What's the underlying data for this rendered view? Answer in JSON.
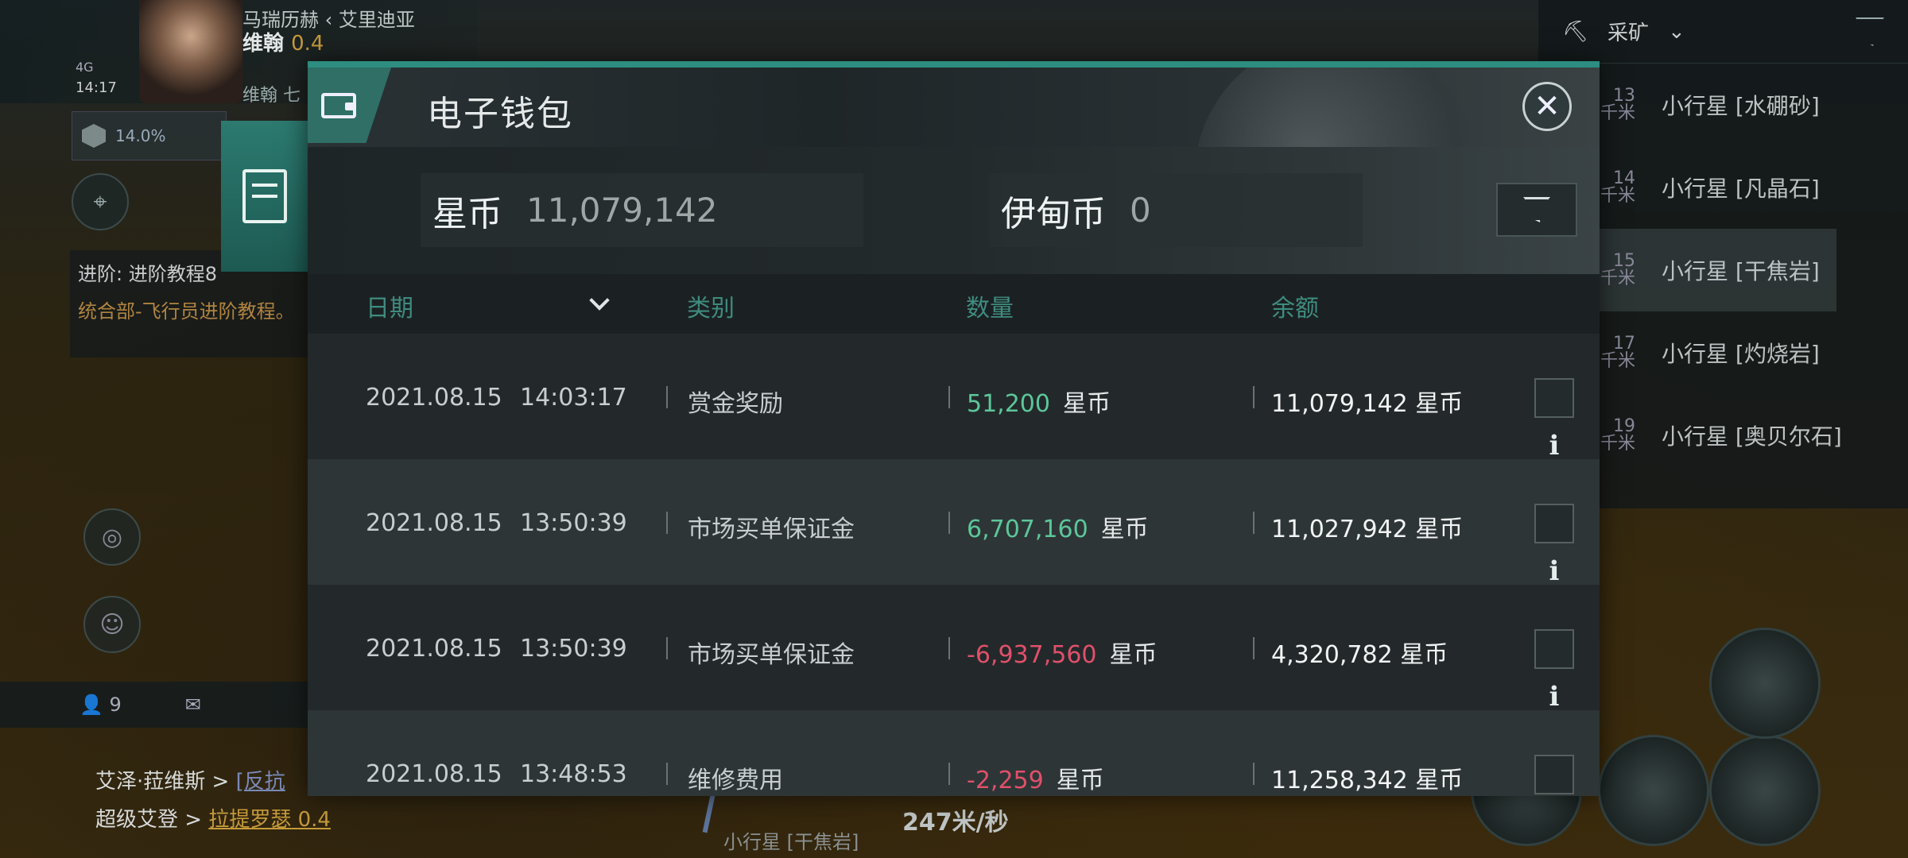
{
  "hud": {
    "pilot_route": "马瑞历赫 ‹ 艾里迪亚",
    "pilot_name": "维翰",
    "security": "0.4",
    "sub_name": "维翰 七",
    "signal": "4G",
    "time": "14:17",
    "cargo_percent": "14.0%",
    "quest_title": "进阶: 进阶教程8",
    "quest_desc": "统合部-飞行员进阶教程。",
    "chat_count": "9",
    "chat_lines": [
      {
        "name": "艾泽·菈维斯 >",
        "target": "[反抗",
        "gold": ""
      },
      {
        "name": "超级艾登 >",
        "target": "拉提罗瑟",
        "gold": "0.4"
      }
    ],
    "speed": "247米/秒",
    "target_label": "小行星 [干焦岩]"
  },
  "overview": {
    "filter_label": "采矿",
    "items": [
      {
        "dist": "13",
        "unit": "千米",
        "name": "小行星 [水硼砂]",
        "active": false
      },
      {
        "dist": "14",
        "unit": "千米",
        "name": "小行星 [凡晶石]",
        "active": false
      },
      {
        "dist": "15",
        "unit": "千米",
        "name": "小行星 [干焦岩]",
        "active": true
      },
      {
        "dist": "17",
        "unit": "千米",
        "name": "小行星 [灼烧岩]",
        "active": false
      },
      {
        "dist": "19",
        "unit": "千米",
        "name": "小行星 [奥贝尔石]",
        "active": false
      }
    ]
  },
  "wallet": {
    "title": "电子钱包",
    "star_label": "星币",
    "star_value": "11,079,142",
    "isk_label": "伊甸币",
    "isk_value": "0",
    "columns": {
      "date": "日期",
      "category": "类别",
      "amount": "数量",
      "balance": "余额"
    },
    "rows": [
      {
        "date": "2021.08.15",
        "time": "14:03:17",
        "category": "赏金奖励",
        "amount": "51,200",
        "sign": "pos",
        "unit": "星币",
        "balance": "11,079,142 星币"
      },
      {
        "date": "2021.08.15",
        "time": "13:50:39",
        "category": "市场买单保证金",
        "amount": "6,707,160",
        "sign": "pos",
        "unit": "星币",
        "balance": "11,027,942 星币"
      },
      {
        "date": "2021.08.15",
        "time": "13:50:39",
        "category": "市场买单保证金",
        "amount": "-6,937,560",
        "sign": "neg",
        "unit": "星币",
        "balance": "4,320,782 星币"
      },
      {
        "date": "2021.08.15",
        "time": "13:48:53",
        "category": "维修费用",
        "amount": "-2,259",
        "sign": "neg",
        "unit": "星币",
        "balance": "11,258,342 星币"
      }
    ]
  },
  "colors": {
    "accent": "#2c8d80",
    "positive": "#5cc79a",
    "negative": "#e0506a"
  }
}
